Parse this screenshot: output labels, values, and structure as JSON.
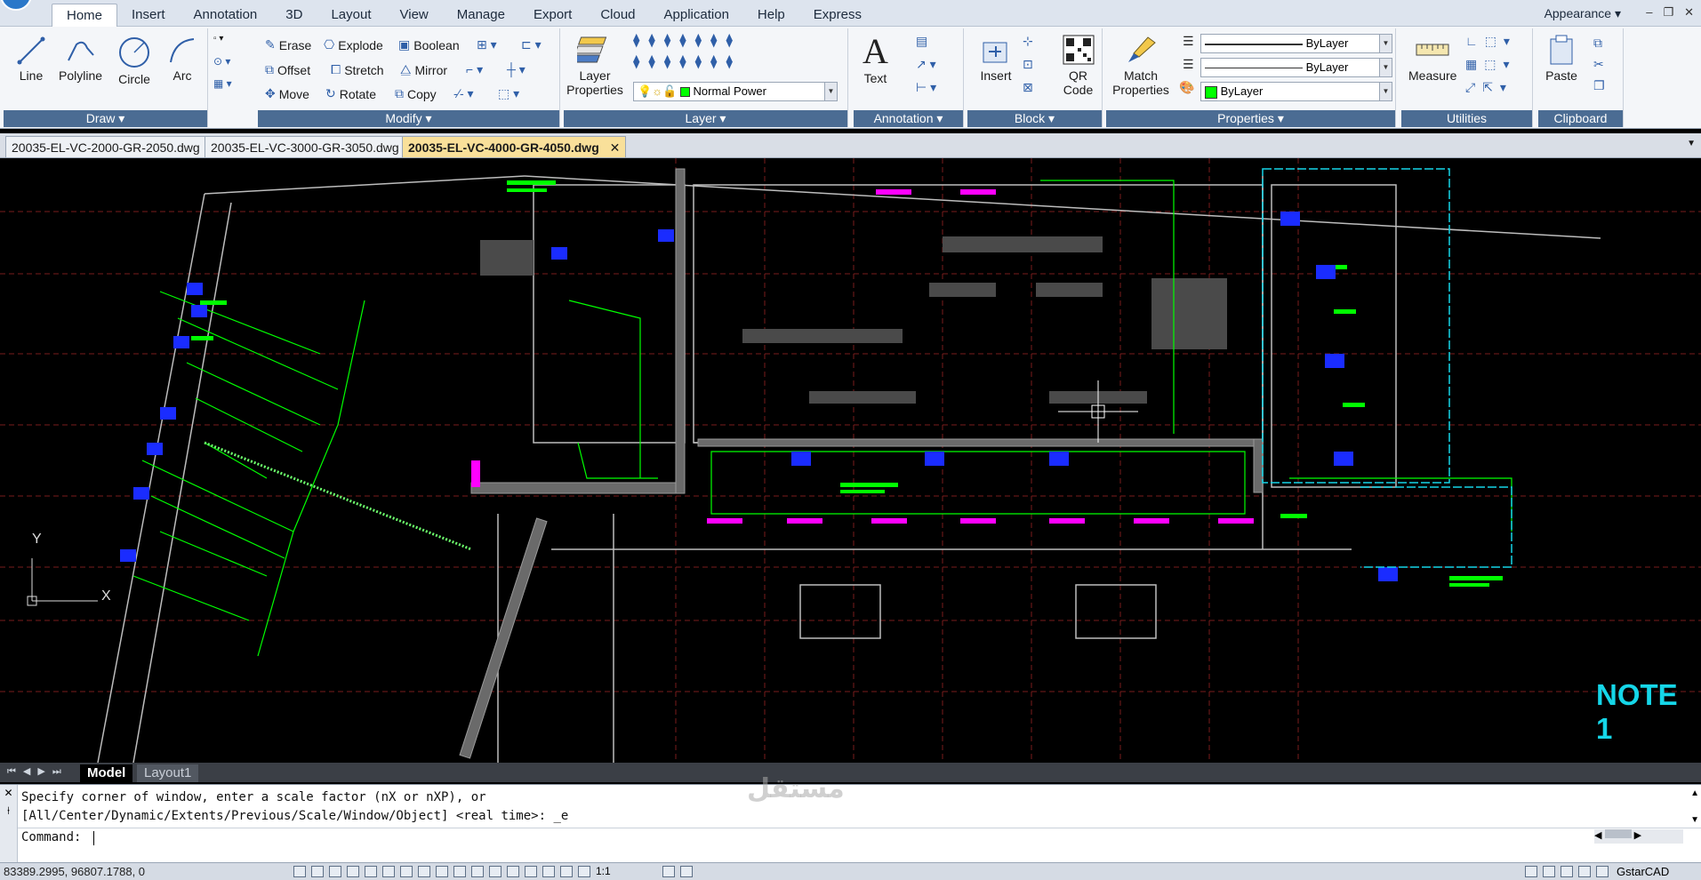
{
  "menu": {
    "tabs": [
      "Home",
      "Insert",
      "Annotation",
      "3D",
      "Layout",
      "View",
      "Manage",
      "Export",
      "Cloud",
      "Application",
      "Help",
      "Express"
    ],
    "active": "Home",
    "appearance": "Appearance"
  },
  "ribbon": {
    "draw": {
      "title": "Draw",
      "line": "Line",
      "polyline": "Polyline",
      "circle": "Circle",
      "arc": "Arc"
    },
    "modify": {
      "title": "Modify",
      "erase": "Erase",
      "explode": "Explode",
      "boolean": "Boolean",
      "offset": "Offset",
      "stretch": "Stretch",
      "mirror": "Mirror",
      "move": "Move",
      "rotate": "Rotate",
      "copy": "Copy"
    },
    "layer": {
      "title": "Layer",
      "properties": "Layer Properties",
      "current": "Normal Power"
    },
    "annotation": {
      "title": "Annotation",
      "text": "Text"
    },
    "block": {
      "title": "Block",
      "insert": "Insert",
      "qr": "QR Code"
    },
    "properties": {
      "title": "Properties",
      "match": "Match Properties",
      "color": "ByLayer",
      "linetype": "ByLayer",
      "lineweight": "ByLayer"
    },
    "utilities": {
      "title": "Utilities",
      "measure": "Measure"
    },
    "clipboard": {
      "title": "Clipboard",
      "paste": "Paste"
    }
  },
  "documents": [
    "20035-EL-VC-2000-GR-2050.dwg",
    "20035-EL-VC-3000-GR-3050.dwg",
    "20035-EL-VC-4000-GR-4050.dwg"
  ],
  "active_document": "20035-EL-VC-4000-GR-4050.dwg",
  "drawing": {
    "note": "NOTE 1",
    "axis_y": "Y",
    "axis_x": "X"
  },
  "layouts": {
    "model": "Model",
    "layout1": "Layout1"
  },
  "command": {
    "line1": "Specify corner of window, enter a scale factor (nX or nXP), or",
    "line2": "[All/Center/Dynamic/Extents/Previous/Scale/Window/Object] <real time>: _e",
    "prompt": "Command:"
  },
  "status": {
    "coords": "83389.2995, 96807.1788, 0",
    "scale": "1:1",
    "app": "GstarCAD"
  },
  "colors": {
    "ribbon_title": "#4b6c93",
    "active_tab": "#f9e09a",
    "cad_green": "#00ff00",
    "cad_blue": "#1a2cff",
    "cad_magenta": "#ff00ff",
    "cad_cyan": "#15d6e8"
  }
}
